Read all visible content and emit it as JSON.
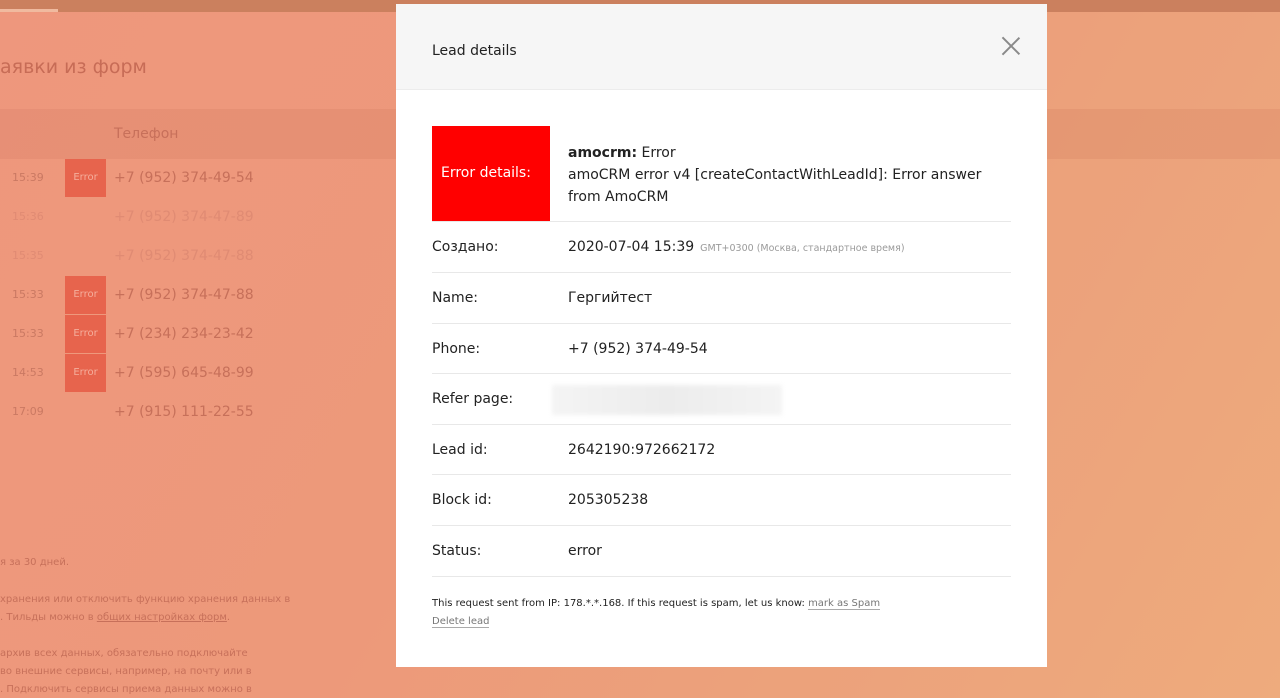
{
  "background": {
    "page_title": "аявки из форм",
    "column_header": "Телефон",
    "rows": [
      {
        "time": "15:39",
        "badge": "Error",
        "phone": "+7 (952) 374-49-54",
        "faded": false
      },
      {
        "time": "15:36",
        "badge": "",
        "phone": "+7 (952) 374-47-89",
        "faded": true
      },
      {
        "time": "15:35",
        "badge": "",
        "phone": "+7 (952) 374-47-88",
        "faded": true
      },
      {
        "time": "15:33",
        "badge": "Error",
        "phone": "+7 (952) 374-47-88",
        "faded": false
      },
      {
        "time": "15:33",
        "badge": "Error",
        "phone": "+7 (234) 234-23-42",
        "faded": false
      },
      {
        "time": "14:53",
        "badge": "Error",
        "phone": "+7 (595) 645-48-99",
        "faded": false
      },
      {
        "time": "17:09",
        "badge": "",
        "phone": "+7 (915) 111-22-55",
        "faded": false
      }
    ],
    "footer": {
      "line1": "я за 30 дней.",
      "line2": "хранения или отключить функцию хранения данных в",
      "line3_prefix": ". Тильды можно в ",
      "line3_link": "общих настройках форм",
      "line3_suffix": ".",
      "line4": "архив всех данных, обязательно подключайте",
      "line5": "во внешние сервисы, например, на почту или в",
      "line6": ". Подключить сервисы приема данных можно в"
    }
  },
  "modal": {
    "title": "Lead details",
    "error": {
      "box_label": "Error details:",
      "source": "amocrm:",
      "source_status": "Error",
      "message": "amoCRM error v4 [createContactWithLeadId]: Error answer from AmoCRM"
    },
    "created": {
      "label": "Создано:",
      "value": "2020-07-04 15:39",
      "timezone": "GMT+0300 (Москва, стандартное время)"
    },
    "name": {
      "label": "Name:",
      "value": "Гергийтест"
    },
    "phone": {
      "label": "Phone:",
      "value": "+7 (952) 374-49-54"
    },
    "refer": {
      "label": "Refer page:"
    },
    "lead_id": {
      "label": "Lead id:",
      "value": "2642190:972662172"
    },
    "block_id": {
      "label": "Block id:",
      "value": "205305238"
    },
    "status": {
      "label": "Status:",
      "value": "error"
    },
    "ip_note": "This request sent from IP: 178.*.*.168. If this request is spam, let us know: ",
    "spam_link": "mark as Spam",
    "delete_link": "Delete lead"
  },
  "colors": {
    "error": "#ff0000",
    "badge": "#e8634c"
  }
}
